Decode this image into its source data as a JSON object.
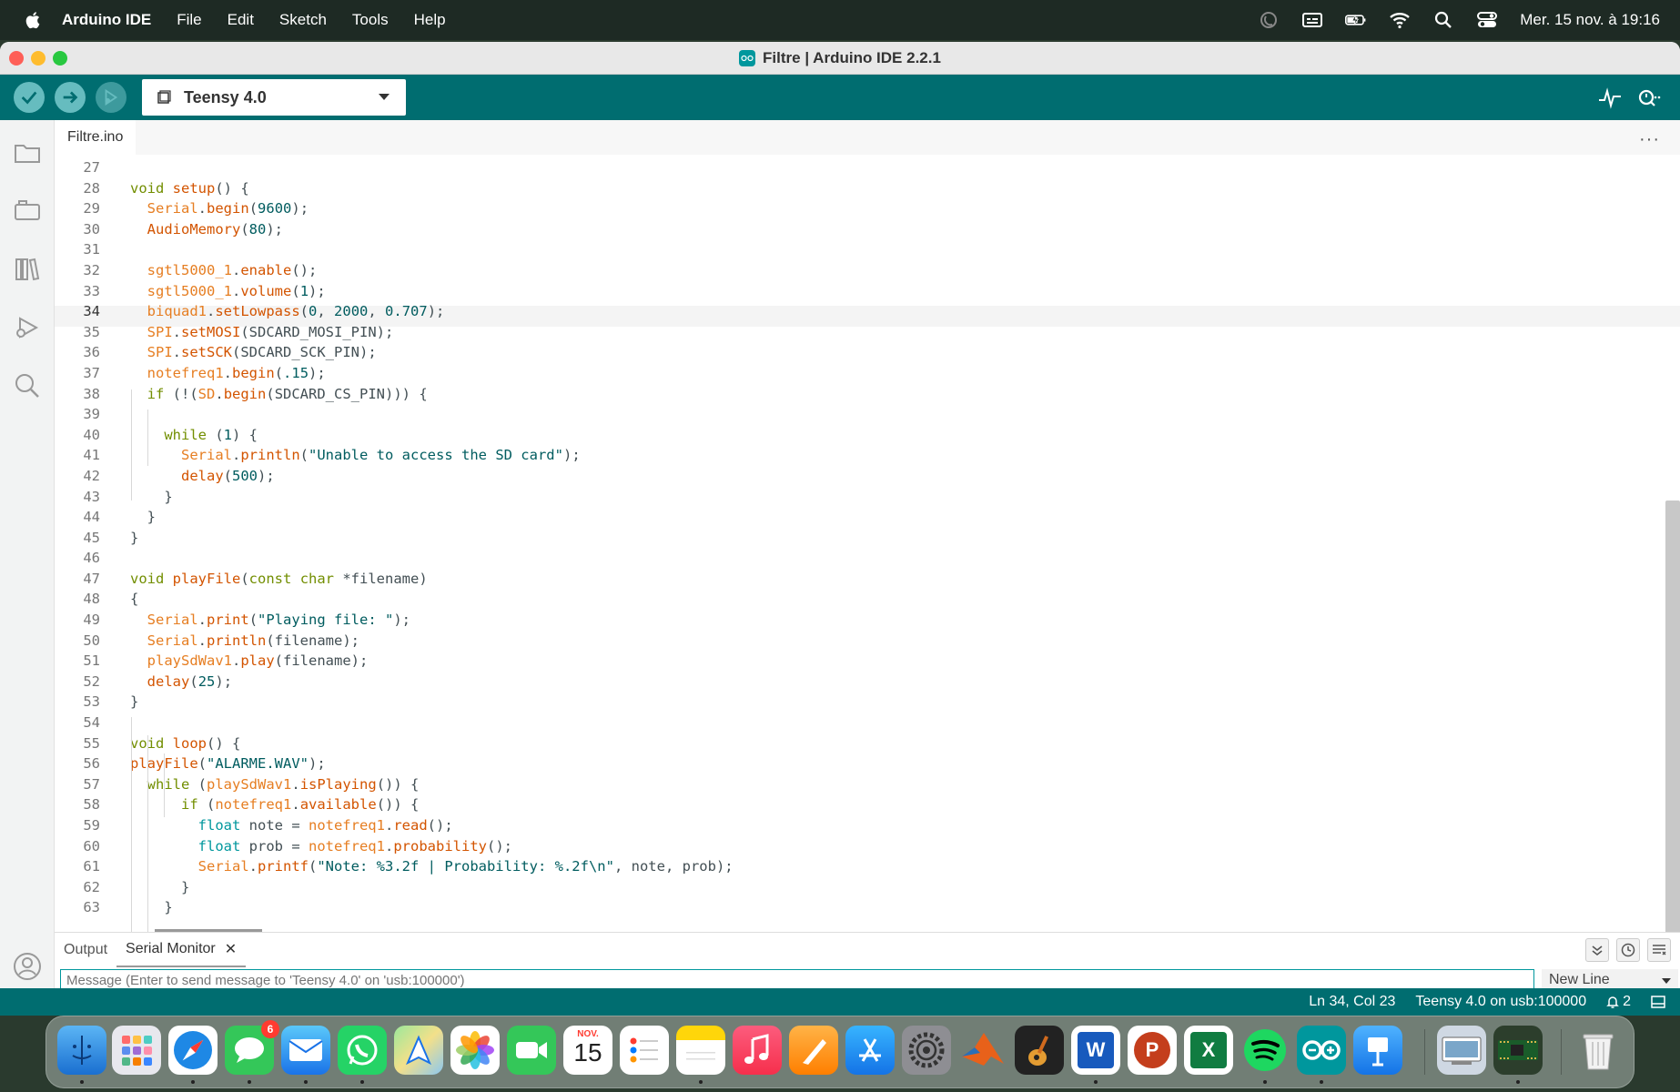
{
  "menubar": {
    "app_name": "Arduino IDE",
    "items": [
      "File",
      "Edit",
      "Sketch",
      "Tools",
      "Help"
    ],
    "clock": "Mer. 15 nov. à 19:16"
  },
  "window": {
    "title": "Filtre | Arduino IDE 2.2.1"
  },
  "toolbar": {
    "board": "Teensy 4.0"
  },
  "editor": {
    "tab": "Filtre.ino",
    "active_line": 34,
    "lines": [
      {
        "n": "27",
        "tokens": []
      },
      {
        "n": "28",
        "tokens": [
          [
            "kw",
            "void "
          ],
          [
            "fn",
            "setup"
          ],
          [
            "def",
            "() {"
          ]
        ]
      },
      {
        "n": "29",
        "tokens": [
          [
            "def",
            "  "
          ],
          [
            "cls",
            "Serial"
          ],
          [
            "def",
            "."
          ],
          [
            "fn",
            "begin"
          ],
          [
            "def",
            "("
          ],
          [
            "num",
            "9600"
          ],
          [
            "def",
            ");"
          ]
        ]
      },
      {
        "n": "30",
        "tokens": [
          [
            "def",
            "  "
          ],
          [
            "fn",
            "AudioMemory"
          ],
          [
            "def",
            "("
          ],
          [
            "num",
            "80"
          ],
          [
            "def",
            ");"
          ]
        ]
      },
      {
        "n": "31",
        "tokens": []
      },
      {
        "n": "32",
        "tokens": [
          [
            "def",
            "  "
          ],
          [
            "cls",
            "sgtl5000_1"
          ],
          [
            "def",
            "."
          ],
          [
            "fn",
            "enable"
          ],
          [
            "def",
            "();"
          ]
        ]
      },
      {
        "n": "33",
        "tokens": [
          [
            "def",
            "  "
          ],
          [
            "cls",
            "sgtl5000_1"
          ],
          [
            "def",
            "."
          ],
          [
            "fn",
            "volume"
          ],
          [
            "def",
            "("
          ],
          [
            "num",
            "1"
          ],
          [
            "def",
            ");"
          ]
        ]
      },
      {
        "n": "34",
        "tokens": [
          [
            "def",
            "  "
          ],
          [
            "cls",
            "biquad1"
          ],
          [
            "def",
            "."
          ],
          [
            "fn",
            "setLowpass"
          ],
          [
            "def",
            "("
          ],
          [
            "num",
            "0"
          ],
          [
            "def",
            ", "
          ],
          [
            "num",
            "2000"
          ],
          [
            "def",
            ", "
          ],
          [
            "num",
            "0.707"
          ],
          [
            "def",
            ");"
          ]
        ]
      },
      {
        "n": "35",
        "tokens": [
          [
            "def",
            "  "
          ],
          [
            "cls",
            "SPI"
          ],
          [
            "def",
            "."
          ],
          [
            "fn",
            "setMOSI"
          ],
          [
            "def",
            "(SDCARD_MOSI_PIN);"
          ]
        ]
      },
      {
        "n": "36",
        "tokens": [
          [
            "def",
            "  "
          ],
          [
            "cls",
            "SPI"
          ],
          [
            "def",
            "."
          ],
          [
            "fn",
            "setSCK"
          ],
          [
            "def",
            "(SDCARD_SCK_PIN);"
          ]
        ]
      },
      {
        "n": "37",
        "tokens": [
          [
            "def",
            "  "
          ],
          [
            "cls",
            "notefreq1"
          ],
          [
            "def",
            "."
          ],
          [
            "fn",
            "begin"
          ],
          [
            "def",
            "("
          ],
          [
            "num",
            ".15"
          ],
          [
            "def",
            ");"
          ]
        ]
      },
      {
        "n": "38",
        "tokens": [
          [
            "def",
            "  "
          ],
          [
            "kw",
            "if"
          ],
          [
            "def",
            " (!("
          ],
          [
            "cls",
            "SD"
          ],
          [
            "def",
            "."
          ],
          [
            "fn",
            "begin"
          ],
          [
            "def",
            "(SDCARD_CS_PIN))) {"
          ]
        ]
      },
      {
        "n": "39",
        "tokens": []
      },
      {
        "n": "40",
        "tokens": [
          [
            "def",
            "    "
          ],
          [
            "kw",
            "while"
          ],
          [
            "def",
            " ("
          ],
          [
            "num",
            "1"
          ],
          [
            "def",
            ") {"
          ]
        ]
      },
      {
        "n": "41",
        "tokens": [
          [
            "def",
            "      "
          ],
          [
            "cls",
            "Serial"
          ],
          [
            "def",
            "."
          ],
          [
            "fn",
            "println"
          ],
          [
            "def",
            "("
          ],
          [
            "str",
            "\"Unable to access the SD card\""
          ],
          [
            "def",
            ");"
          ]
        ]
      },
      {
        "n": "42",
        "tokens": [
          [
            "def",
            "      "
          ],
          [
            "fn",
            "delay"
          ],
          [
            "def",
            "("
          ],
          [
            "num",
            "500"
          ],
          [
            "def",
            ");"
          ]
        ]
      },
      {
        "n": "43",
        "tokens": [
          [
            "def",
            "    }"
          ]
        ]
      },
      {
        "n": "44",
        "tokens": [
          [
            "def",
            "  }"
          ]
        ]
      },
      {
        "n": "45",
        "tokens": [
          [
            "def",
            "}"
          ]
        ]
      },
      {
        "n": "46",
        "tokens": []
      },
      {
        "n": "47",
        "tokens": [
          [
            "kw",
            "void "
          ],
          [
            "fn",
            "playFile"
          ],
          [
            "def",
            "("
          ],
          [
            "kw",
            "const"
          ],
          [
            "def",
            " "
          ],
          [
            "kw",
            "char"
          ],
          [
            "def",
            " *filename)"
          ]
        ]
      },
      {
        "n": "48",
        "tokens": [
          [
            "def",
            "{"
          ]
        ]
      },
      {
        "n": "49",
        "tokens": [
          [
            "def",
            "  "
          ],
          [
            "cls",
            "Serial"
          ],
          [
            "def",
            "."
          ],
          [
            "fn",
            "print"
          ],
          [
            "def",
            "("
          ],
          [
            "str",
            "\"Playing file: \""
          ],
          [
            "def",
            ");"
          ]
        ]
      },
      {
        "n": "50",
        "tokens": [
          [
            "def",
            "  "
          ],
          [
            "cls",
            "Serial"
          ],
          [
            "def",
            "."
          ],
          [
            "fn",
            "println"
          ],
          [
            "def",
            "(filename);"
          ]
        ]
      },
      {
        "n": "51",
        "tokens": [
          [
            "def",
            "  "
          ],
          [
            "cls",
            "playSdWav1"
          ],
          [
            "def",
            "."
          ],
          [
            "fn",
            "play"
          ],
          [
            "def",
            "(filename);"
          ]
        ]
      },
      {
        "n": "52",
        "tokens": [
          [
            "def",
            "  "
          ],
          [
            "fn",
            "delay"
          ],
          [
            "def",
            "("
          ],
          [
            "num",
            "25"
          ],
          [
            "def",
            ");"
          ]
        ]
      },
      {
        "n": "53",
        "tokens": [
          [
            "def",
            "}"
          ]
        ]
      },
      {
        "n": "54",
        "tokens": []
      },
      {
        "n": "55",
        "tokens": [
          [
            "kw",
            "void "
          ],
          [
            "fn",
            "loop"
          ],
          [
            "def",
            "() {"
          ]
        ]
      },
      {
        "n": "56",
        "tokens": [
          [
            "fn",
            "playFile"
          ],
          [
            "def",
            "("
          ],
          [
            "str",
            "\"ALARME.WAV\""
          ],
          [
            "def",
            ");"
          ]
        ]
      },
      {
        "n": "57",
        "tokens": [
          [
            "def",
            "  "
          ],
          [
            "kw",
            "while"
          ],
          [
            "def",
            " ("
          ],
          [
            "cls",
            "playSdWav1"
          ],
          [
            "def",
            "."
          ],
          [
            "fn",
            "isPlaying"
          ],
          [
            "def",
            "()) {"
          ]
        ]
      },
      {
        "n": "58",
        "tokens": [
          [
            "def",
            "      "
          ],
          [
            "kw",
            "if"
          ],
          [
            "def",
            " ("
          ],
          [
            "cls",
            "notefreq1"
          ],
          [
            "def",
            "."
          ],
          [
            "fn",
            "available"
          ],
          [
            "def",
            "()) {"
          ]
        ]
      },
      {
        "n": "59",
        "tokens": [
          [
            "def",
            "        "
          ],
          [
            "ty",
            "float"
          ],
          [
            "def",
            " note = "
          ],
          [
            "cls",
            "notefreq1"
          ],
          [
            "def",
            "."
          ],
          [
            "fn",
            "read"
          ],
          [
            "def",
            "();"
          ]
        ]
      },
      {
        "n": "60",
        "tokens": [
          [
            "def",
            "        "
          ],
          [
            "ty",
            "float"
          ],
          [
            "def",
            " prob = "
          ],
          [
            "cls",
            "notefreq1"
          ],
          [
            "def",
            "."
          ],
          [
            "fn",
            "probability"
          ],
          [
            "def",
            "();"
          ]
        ]
      },
      {
        "n": "61",
        "tokens": [
          [
            "def",
            "        "
          ],
          [
            "cls",
            "Serial"
          ],
          [
            "def",
            "."
          ],
          [
            "fn",
            "printf"
          ],
          [
            "def",
            "("
          ],
          [
            "str",
            "\"Note: %3.2f | Probability: %.2f\\n\""
          ],
          [
            "def",
            ", note, prob);"
          ]
        ]
      },
      {
        "n": "62",
        "tokens": [
          [
            "def",
            "      }"
          ]
        ]
      },
      {
        "n": "63",
        "tokens": [
          [
            "def",
            "    }"
          ]
        ]
      }
    ]
  },
  "panel": {
    "tabs": [
      "Output",
      "Serial Monitor"
    ],
    "active_tab": "Serial Monitor",
    "message_placeholder": "Message (Enter to send message to 'Teensy 4.0' on 'usb:100000')",
    "line_ending": "New Line"
  },
  "statusbar": {
    "position": "Ln 34, Col 23",
    "board_port": "Teensy 4.0 on usb:100000",
    "notifications": "2"
  },
  "dock": {
    "messages_badge": "6",
    "calendar_month": "NOV.",
    "calendar_day": "15",
    "apps": [
      "Finder",
      "Launchpad",
      "Safari",
      "Messages",
      "Mail",
      "WhatsApp",
      "Maps",
      "Photos",
      "FaceTime",
      "Calendar",
      "Reminders",
      "Notes",
      "Music",
      "Pages",
      "App Store",
      "System Settings",
      "MATLAB",
      "GarageBand",
      "Word",
      "PowerPoint",
      "Excel",
      "Spotify",
      "Arduino IDE",
      "Keynote",
      "Preview",
      "Teensy",
      "Trash"
    ]
  }
}
